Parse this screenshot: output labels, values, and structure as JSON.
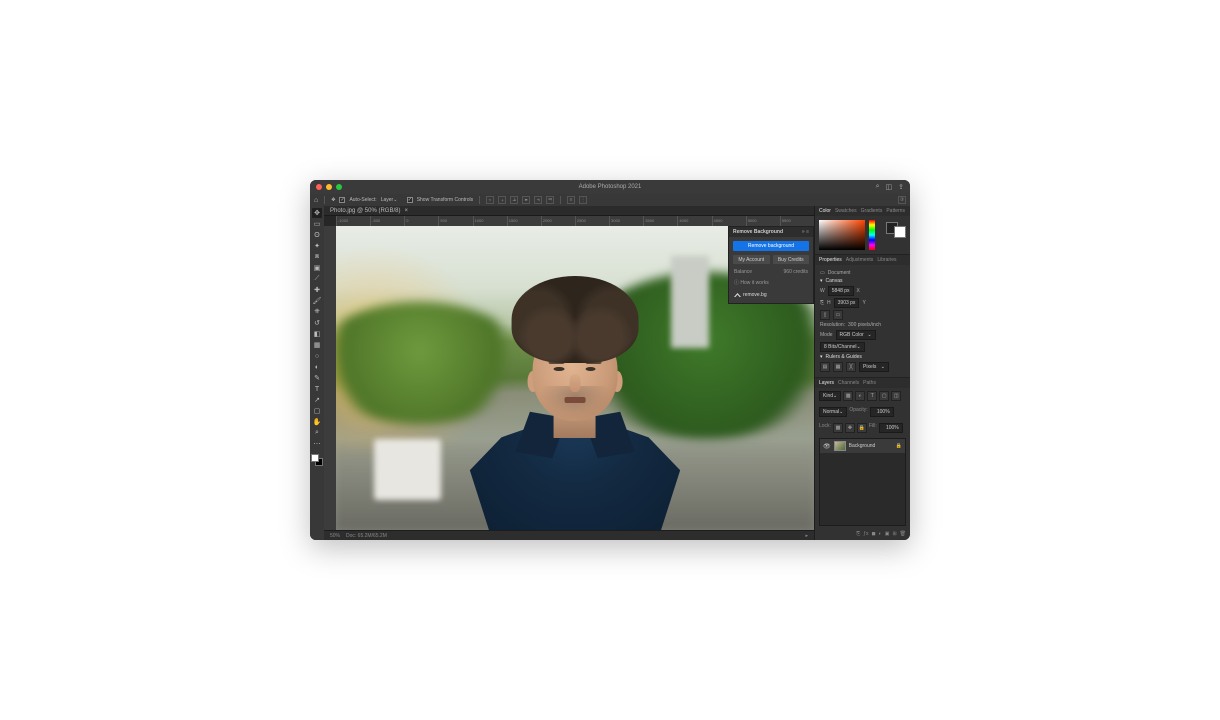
{
  "app": {
    "title": "Adobe Photoshop 2021"
  },
  "titlebar_icons": [
    "search",
    "workspace",
    "share"
  ],
  "options": {
    "auto_select_label": "Auto-Select:",
    "target": "Layer",
    "transform_label": "Show Transform Controls"
  },
  "tools": [
    "move",
    "marquee",
    "lasso",
    "wand",
    "crop",
    "frame",
    "eyedrop",
    "heal",
    "brush",
    "stamp",
    "history",
    "eraser",
    "gradient",
    "blur",
    "dodge",
    "pen",
    "type",
    "path",
    "rect",
    "hand",
    "zoom",
    "more"
  ],
  "active_tool": "move",
  "document": {
    "tab": "Photo.jpg @ 50% (RGB/8)",
    "zoom": "50%"
  },
  "ruler_ticks": [
    "-1000",
    "-500",
    "0",
    "500",
    "1000",
    "1500",
    "2000",
    "2500",
    "3000",
    "3500",
    "4000",
    "4500",
    "5000",
    "5500"
  ],
  "plugin": {
    "title": "Remove Background",
    "primary": "Remove background",
    "account": "My Account",
    "buy": "Buy Credits",
    "balance_label": "Balance",
    "balance_value": "960 credits",
    "howto": "How it works",
    "brand": "remove.bg"
  },
  "color_tabs": [
    "Color",
    "Swatches",
    "Gradients",
    "Patterns"
  ],
  "props": {
    "tabs": [
      "Properties",
      "Adjustments",
      "Libraries"
    ],
    "doc_label": "Document",
    "canvas_label": "Canvas",
    "w_label": "W",
    "w_value": "5848 px",
    "h_label": "H",
    "h_value": "3903 px",
    "x_label": "X",
    "y_label": "Y",
    "res_label": "Resolution:",
    "res_value": "300 pixels/inch",
    "mode_label": "Mode",
    "mode_value": "RGB Color",
    "depth": "8 Bits/Channel",
    "rulers_label": "Rulers & Guides",
    "units": "Pixels"
  },
  "layers": {
    "tabs": [
      "Layers",
      "Channels",
      "Paths"
    ],
    "kind": "Kind",
    "blend": "Normal",
    "opacity_label": "Opacity:",
    "opacity": "100%",
    "lock_label": "Lock:",
    "fill_label": "Fill:",
    "fill": "100%",
    "layer_name": "Background"
  },
  "status": {
    "zoom": "50%",
    "info": "Doc: 65.2M/65.2M"
  }
}
